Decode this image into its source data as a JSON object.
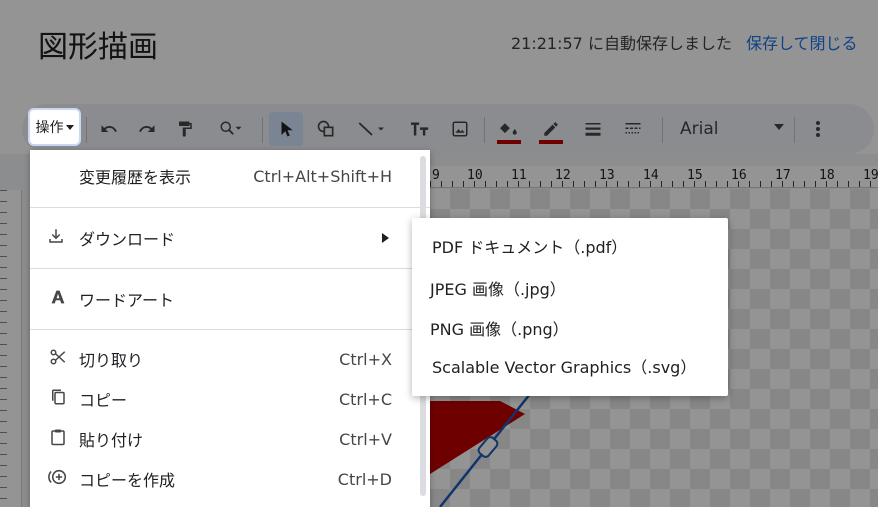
{
  "header": {
    "title": "図形描画",
    "autosave_text": "21:21:57 に自動保存しました",
    "save_close_label": "保存して閉じる"
  },
  "toolbar": {
    "operations_label": "操作",
    "font_name": "Arial"
  },
  "ruler": {
    "top_numbers": [
      "9",
      "10",
      "11",
      "12",
      "13",
      "14",
      "15",
      "16",
      "17",
      "18",
      "19"
    ]
  },
  "menu": {
    "items": [
      {
        "label": "変更履歴を表示",
        "shortcut": "Ctrl+Alt+Shift+H",
        "icon": ""
      },
      {
        "label": "ダウンロード",
        "shortcut": "",
        "icon": "download-icon"
      },
      {
        "label": "ワードアート",
        "shortcut": "",
        "icon": "wordart-icon"
      },
      {
        "label": "切り取り",
        "shortcut": "Ctrl+X",
        "icon": "scissors-icon"
      },
      {
        "label": "コピー",
        "shortcut": "Ctrl+C",
        "icon": "copy-icon"
      },
      {
        "label": "貼り付け",
        "shortcut": "Ctrl+V",
        "icon": "paste-icon"
      },
      {
        "label": "コピーを作成",
        "shortcut": "Ctrl+D",
        "icon": "duplicate-icon"
      }
    ]
  },
  "submenu": {
    "items": [
      {
        "label": "PDF ドキュメント（.pdf）"
      },
      {
        "label": "JPEG 画像（.jpg）"
      },
      {
        "label": "PNG 画像（.png）"
      },
      {
        "label": "Scalable Vector Graphics（.svg）"
      }
    ]
  },
  "colors": {
    "accent": "#1a73e8",
    "fill_color": "#c00000",
    "line_color": "#c00000",
    "shape_line": "#1f5ab8"
  }
}
